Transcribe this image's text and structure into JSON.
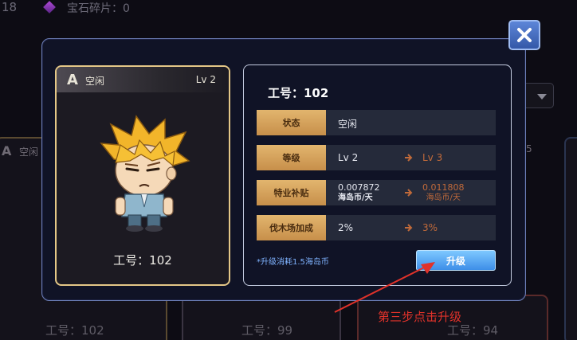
{
  "topbar": {
    "count": "18",
    "gem_label": "宝石碎片：0"
  },
  "background": {
    "rank": "A",
    "status": "空闲",
    "side_number": "5",
    "workers": [
      "工号：102",
      "工号：99",
      "工号：94"
    ]
  },
  "character": {
    "rank": "A",
    "status": "空闲",
    "level": "Lv 2",
    "id_label": "工号：102"
  },
  "info": {
    "title": "工号：102",
    "rows": [
      {
        "label": "状态",
        "current": "空闲"
      },
      {
        "label": "等级",
        "current": "Lv 2",
        "next": "Lv 3"
      },
      {
        "label": "特业补贴",
        "current": "0.007872",
        "current_unit": "海岛币/天",
        "next": "0.011808",
        "next_unit": "海岛币/天"
      },
      {
        "label": "伐木场加成",
        "current": "2%",
        "next": "3%"
      }
    ],
    "cost_note": "*升级消耗1.5海岛币",
    "upgrade_label": "升级"
  },
  "annotation": {
    "text": "第三步点击升级",
    "color": "#e0322a"
  },
  "colors": {
    "card_border": "#e4c787",
    "label_gold": "#d9a65e",
    "next_value": "#c06a3a",
    "upgrade_button": "#4ea3f0",
    "cost_text": "#7fb3ff"
  }
}
